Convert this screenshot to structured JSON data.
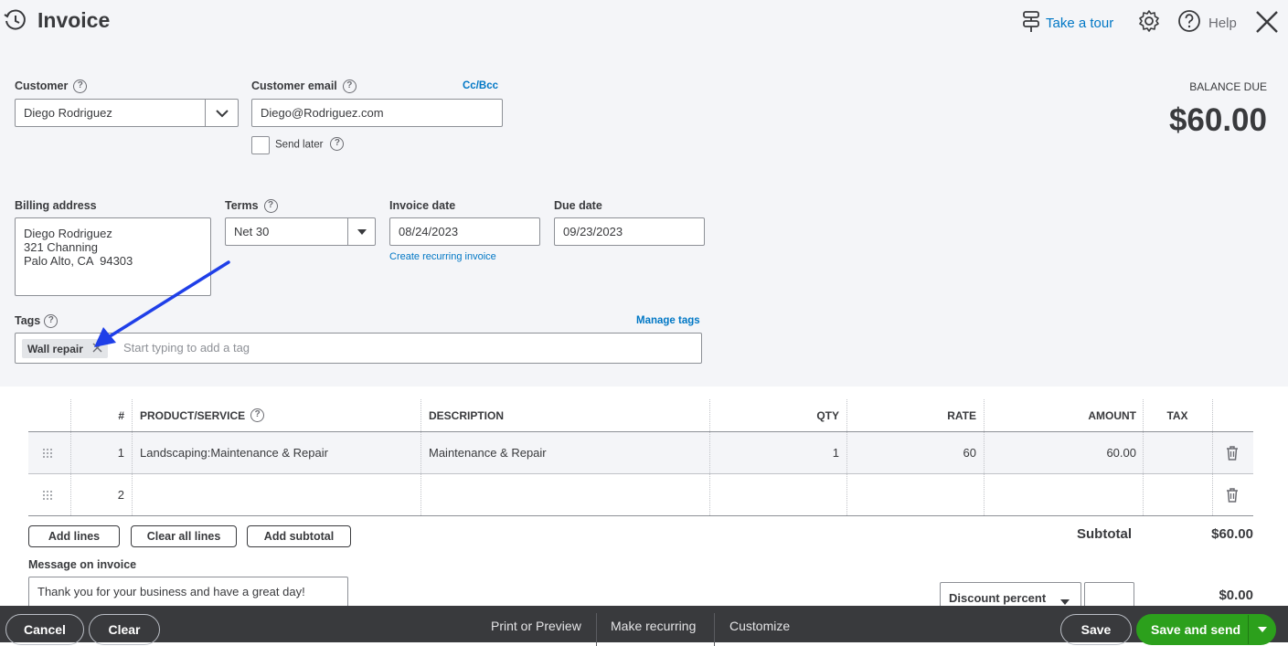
{
  "header": {
    "title": "Invoice",
    "take_tour": "Take a tour",
    "help": "Help"
  },
  "customer": {
    "label": "Customer",
    "value": "Diego Rodriguez"
  },
  "email": {
    "label": "Customer email",
    "value": "Diego@Rodriguez.com",
    "cc_bcc": "Cc/Bcc",
    "send_later": "Send later"
  },
  "balance": {
    "label": "BALANCE DUE",
    "amount": "$60.00"
  },
  "billing": {
    "label": "Billing address",
    "lines": [
      "Diego Rodriguez",
      "321 Channing",
      "Palo Alto, CA  94303"
    ]
  },
  "terms": {
    "label": "Terms",
    "value": "Net 30"
  },
  "invoice_date": {
    "label": "Invoice date",
    "value": "08/24/2023",
    "recurring_link": "Create recurring invoice"
  },
  "due_date": {
    "label": "Due date",
    "value": "09/23/2023"
  },
  "tags": {
    "label": "Tags",
    "manage": "Manage tags",
    "chip": "Wall repair",
    "placeholder": "Start typing to add a tag"
  },
  "table": {
    "headers": {
      "num": "#",
      "product": "PRODUCT/SERVICE",
      "description": "DESCRIPTION",
      "qty": "QTY",
      "rate": "RATE",
      "amount": "AMOUNT",
      "tax": "TAX"
    },
    "rows": [
      {
        "num": "1",
        "product": "Landscaping:Maintenance & Repair",
        "description": "Maintenance & Repair",
        "qty": "1",
        "rate": "60",
        "amount": "60.00"
      },
      {
        "num": "2",
        "product": "",
        "description": "",
        "qty": "",
        "rate": "",
        "amount": ""
      }
    ]
  },
  "actions": {
    "add_lines": "Add lines",
    "clear_all": "Clear all lines",
    "add_subtotal": "Add subtotal"
  },
  "totals": {
    "subtotal_label": "Subtotal",
    "subtotal_value": "$60.00",
    "discount_option": "Discount percent",
    "discount_amount": "$0.00"
  },
  "message": {
    "label": "Message on invoice",
    "value": "Thank you for your business and have a great day!"
  },
  "footer": {
    "cancel": "Cancel",
    "clear": "Clear",
    "print_preview": "Print or Preview",
    "make_recurring": "Make recurring",
    "customize": "Customize",
    "save": "Save",
    "save_send": "Save and send"
  },
  "colors": {
    "link": "#0077c5",
    "primary_green": "#2ca01c",
    "annotation_arrow": "#1f3fe8",
    "footer_bg": "#393a3d"
  }
}
